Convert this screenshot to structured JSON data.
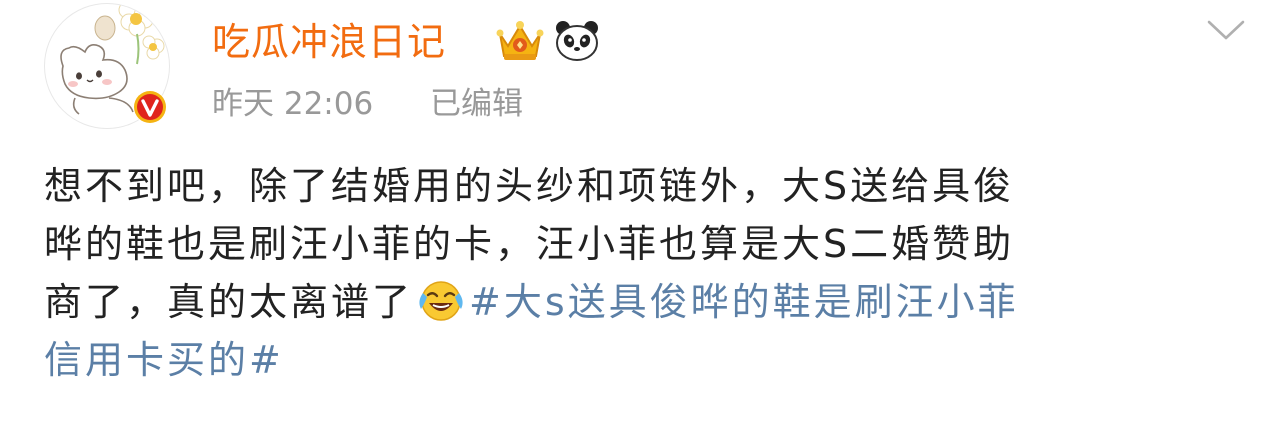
{
  "post": {
    "author": {
      "name": "吃瓜冲浪日记",
      "badges": [
        "crown-icon",
        "panda-icon"
      ]
    },
    "meta": {
      "time": "昨天 22:06",
      "edited": "已编辑"
    },
    "body": {
      "line1": "想不到吧，除了结婚用的头纱和项链外，大S送给具俊",
      "line2": "晔的鞋也是刷汪小菲的卡，汪小菲也算是大S二婚赞助",
      "line3_text": "商了，真的太离谱了",
      "line3_emoji": "laughing-crying-emoji",
      "hashtag_part1": "#大s送具俊晔的鞋是刷汪小菲",
      "hashtag_part2": "信用卡买的#"
    }
  },
  "colors": {
    "username": "#f26c10",
    "meta_text": "#999999",
    "body_text": "#222222",
    "hashtag": "#5b7fa6",
    "verified_badge": "#e0241c",
    "badge_gold": "#f5b312"
  }
}
